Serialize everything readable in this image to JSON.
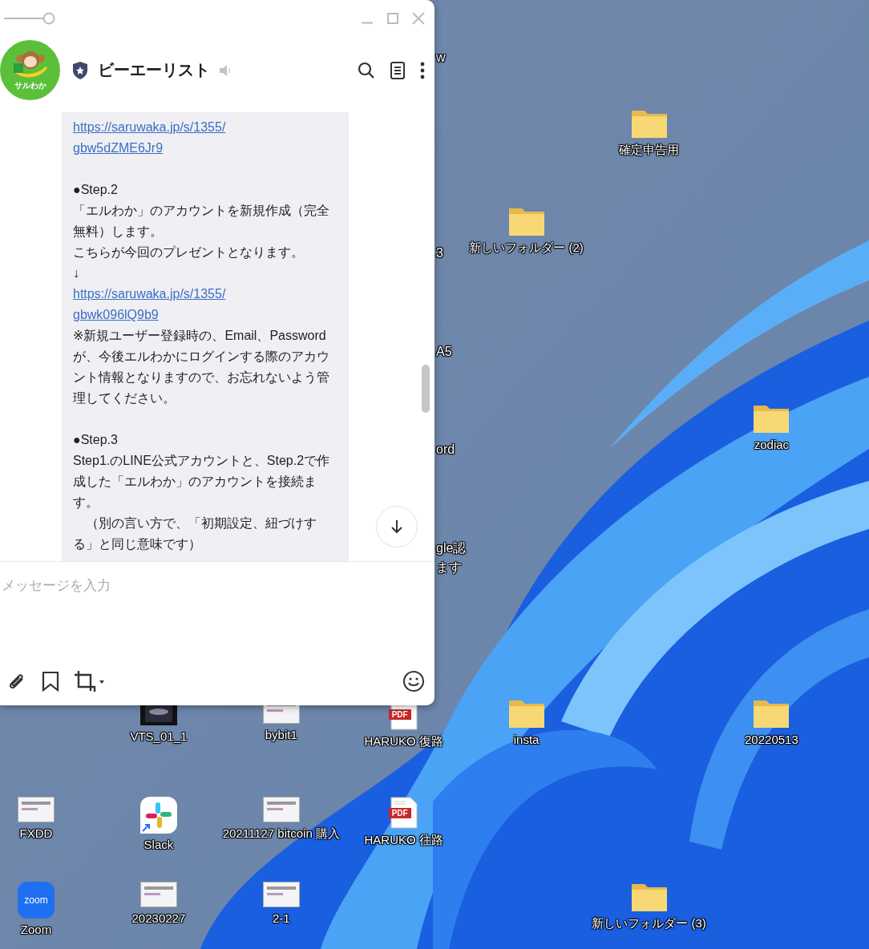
{
  "chat_window": {
    "header": {
      "avatar_text": "サルわか",
      "name": "ビーエーリスト"
    },
    "message": {
      "blocks": [
        {
          "kind": "link",
          "lines": [
            "https://saruwaka.jp/s/1355/",
            "gbw5dZME6Jr9"
          ]
        },
        {
          "kind": "step",
          "text": "●Step.2"
        },
        {
          "kind": "text",
          "text": "「エルわか」のアカウントを新規作成（完全無料）します。"
        },
        {
          "kind": "text",
          "text": "こちらが今回のプレゼントとなります。"
        },
        {
          "kind": "text",
          "text": "↓"
        },
        {
          "kind": "link",
          "lines": [
            "https://saruwaka.jp/s/1355/",
            "gbwk096lQ9b9"
          ]
        },
        {
          "kind": "text",
          "text": "※新規ユーザー登録時の、Email、Passwordが、今後エルわかにログインする際のアカウント情報となりますので、お忘れないよう管理してください。"
        },
        {
          "kind": "step",
          "text": "●Step.3"
        },
        {
          "kind": "text",
          "text": "Step1.のLINE公式アカウントと、Step.2で作成した「エルわか」のアカウントを接続ます。"
        },
        {
          "kind": "text",
          "text": "　（別の言い方で、「初期設定、紐づけする」と同じ意味です）"
        }
      ]
    },
    "input": {
      "placeholder": "メッセージを入力"
    }
  },
  "desktop": {
    "icons": [
      {
        "kind": "folder",
        "label": "確定申告用"
      },
      {
        "kind": "folder",
        "label": "新しいフォルダー (2)"
      },
      {
        "kind": "folder",
        "label": "zodiac"
      },
      {
        "kind": "video",
        "label": "VTS_01_1"
      },
      {
        "kind": "image",
        "label": "bybit1"
      },
      {
        "kind": "pdf",
        "label": "HARUKO 復路",
        "badge": "PDF"
      },
      {
        "kind": "folder",
        "label": "insta"
      },
      {
        "kind": "folder",
        "label": "20220513"
      },
      {
        "kind": "image",
        "label": "FXDD"
      },
      {
        "kind": "slack",
        "label": "Slack"
      },
      {
        "kind": "image",
        "label": "20211127 bitcoin 購入"
      },
      {
        "kind": "pdf",
        "label": "HARUKO 往路",
        "badge": "PDF"
      },
      {
        "kind": "zoom",
        "label": "Zoom",
        "badge": "zoom"
      },
      {
        "kind": "image",
        "label": "20230227"
      },
      {
        "kind": "image",
        "label": "2-1"
      },
      {
        "kind": "folder",
        "label": "新しいフォルダー (3)"
      }
    ],
    "partial_labels": [
      "w",
      "3",
      "A5",
      "ord",
      "gle認",
      "ます"
    ]
  }
}
